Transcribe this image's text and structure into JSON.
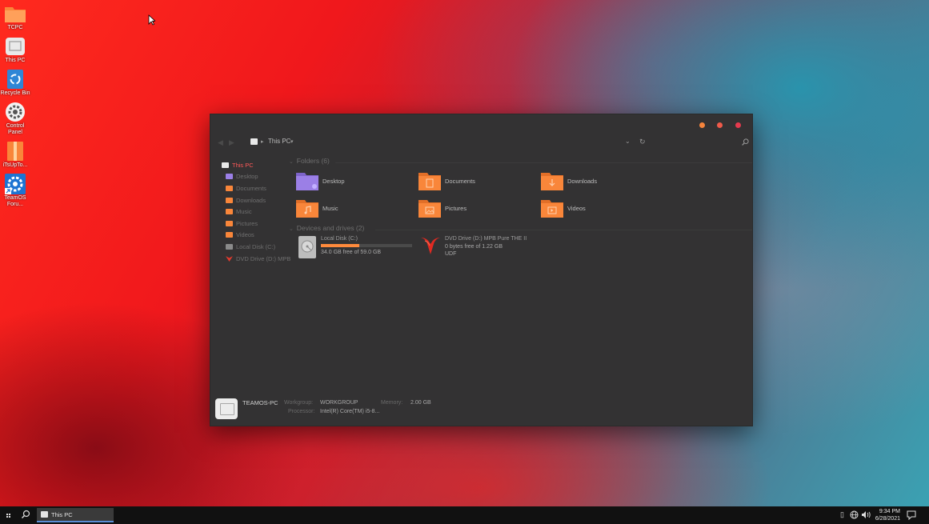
{
  "desktop": {
    "icons": [
      {
        "label": "TCPC",
        "icon": "folder-icon"
      },
      {
        "label": "This PC",
        "icon": "pc-icon"
      },
      {
        "label": "Recycle Bin",
        "icon": "recycle-bin-icon"
      },
      {
        "label": "Control Panel",
        "icon": "gear-icon"
      },
      {
        "label": "iTsUpTo...",
        "icon": "archive-icon"
      },
      {
        "label": "TeamOS Foru...",
        "icon": "settings-shortcut-icon"
      }
    ]
  },
  "explorer": {
    "address": {
      "location": "This PC"
    },
    "sidebar": [
      {
        "label": "This PC",
        "active": true
      },
      {
        "label": "Desktop"
      },
      {
        "label": "Documents"
      },
      {
        "label": "Downloads"
      },
      {
        "label": "Music"
      },
      {
        "label": "Pictures"
      },
      {
        "label": "Videos"
      },
      {
        "label": "Local Disk (C:)"
      },
      {
        "label": "DVD Drive (D:) MPB"
      }
    ],
    "folders_header": "Folders (6)",
    "folders": [
      {
        "label": "Desktop",
        "icon": "desktop-folder-icon",
        "color": "#9b7fe6"
      },
      {
        "label": "Documents",
        "icon": "documents-folder-icon",
        "color": "#f9863a"
      },
      {
        "label": "Downloads",
        "icon": "downloads-folder-icon",
        "color": "#f9863a"
      },
      {
        "label": "Music",
        "icon": "music-folder-icon",
        "color": "#f9863a"
      },
      {
        "label": "Pictures",
        "icon": "pictures-folder-icon",
        "color": "#f9863a"
      },
      {
        "label": "Videos",
        "icon": "videos-folder-icon",
        "color": "#f9863a"
      }
    ],
    "drives_header": "Devices and drives (2)",
    "drives": [
      {
        "name": "Local Disk (C:)",
        "free_text": "34.0 GB free of 59.0 GB",
        "used_fraction": 0.42,
        "icon": "hard-disk-icon"
      },
      {
        "name": "DVD Drive (D:) MPB Pure THE II",
        "free_text": "0 bytes free of 1.22 GB",
        "fs": "UDF",
        "icon": "dvd-drive-icon"
      }
    ],
    "details": {
      "pc_name": "TEAMOS-PC",
      "workgroup_label": "Workgroup:",
      "workgroup_value": "WORKGROUP",
      "memory_label": "Memory:",
      "memory_value": "2.00 GB",
      "processor_label": "Processor:",
      "processor_value": "Intel(R) Core(TM) i5-8..."
    }
  },
  "taskbar": {
    "app_label": "This PC",
    "time": "9:34 PM",
    "date": "6/28/2021"
  },
  "colors": {
    "accent": "#f9863a",
    "active_text": "#ff5959",
    "window_bg": "#333233"
  }
}
